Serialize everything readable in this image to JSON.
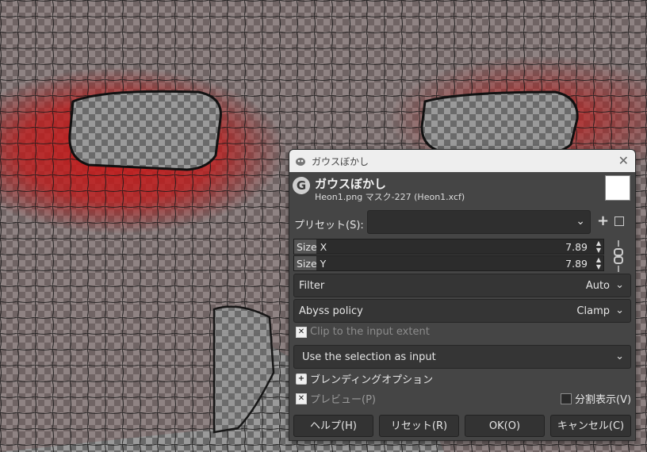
{
  "dialog": {
    "window_title": "ガウスぼかし",
    "filter_title": "ガウスぼかし",
    "subtitle": "Heon1.png マスク-227 (Heon1.xcf)",
    "preset_label": "プリセット(S):",
    "preset_value": "",
    "size_x": {
      "label": "Size X",
      "value": "7.89"
    },
    "size_y": {
      "label": "Size Y",
      "value": "7.89"
    },
    "filter": {
      "label": "Filter",
      "value": "Auto"
    },
    "abyss": {
      "label": "Abyss policy",
      "value": "Clamp"
    },
    "clip_label": "Clip to the input extent",
    "clip_checked": true,
    "selection_input": "Use the selection as input",
    "blending_label": "ブレンディングオプション",
    "preview_label": "プレビュー(P)",
    "preview_checked": true,
    "split_label": "分割表示(V)",
    "split_checked": false,
    "buttons": {
      "help": "ヘルプ(H)",
      "reset": "リセット(R)",
      "ok": "OK(O)",
      "cancel": "キャンセル(C)"
    }
  }
}
